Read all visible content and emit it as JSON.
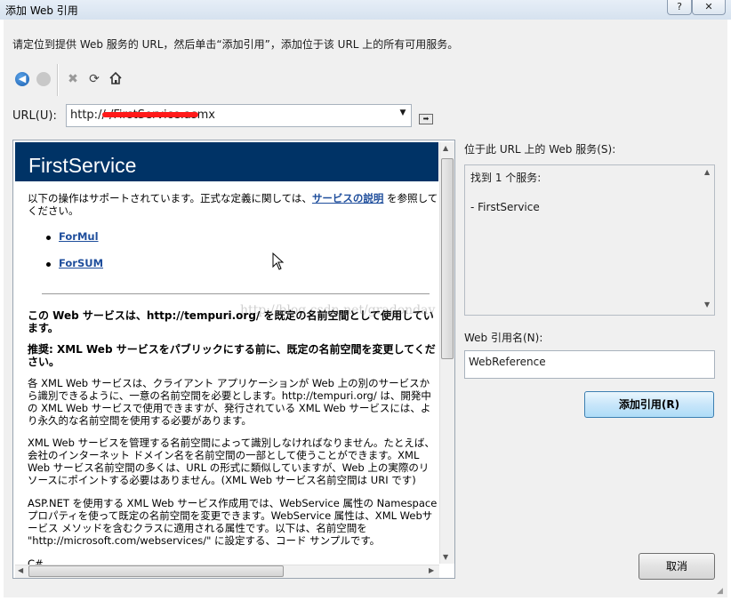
{
  "window": {
    "title": "添加 Web 引用",
    "help_button": "?",
    "close_button": "✕"
  },
  "instruction": "请定位到提供 Web 服务的 URL，然后单击“添加引用”，添加位于该 URL 上的所有可用服务。",
  "toolbar": {
    "back_icon": "arrow-left-icon",
    "stop_icon": "stop-icon",
    "cancel_icon": "x-icon",
    "refresh_icon": "refresh-icon",
    "home_icon": "home-icon"
  },
  "url": {
    "label": "URL(U):",
    "value": "http://                            /FirstService.asmx"
  },
  "browser": {
    "service_title": "FirstService",
    "intro_pre": "以下の操作はサポートされています。正式な定義に関しては、",
    "intro_link": "サービスの説明",
    "intro_post": "を参照してください。",
    "operations": [
      "ForMul",
      "ForSUM"
    ],
    "namespace_notice": "この Web サービスは、http://tempuri.org/ を既定の名前空間として使用しています。",
    "recommend_heading": "推奨: XML Web サービスをパブリックにする前に、既定の名前空間を変更してください。",
    "para1": "各 XML Web サービスは、クライアント アプリケーションが Web 上の別のサービスから識別できるように、一意の名前空間を必要とします。http://tempuri.org/ は、開発中の XML Web サービスで使用できますが、発行されている XML Web サービスには、より永久的な名前空間を使用する必要があります。",
    "para2": "XML Web サービスを管理する名前空間によって識別しなければなりません。たとえば、会社のインターネット ドメイン名を名前空間の一部として使うことができます。XML Web サービス名前空間の多くは、URL の形式に類似していますが、Web 上の実際のリソースにポイントする必要はありません。(XML Web サービス名前空間は URI です)",
    "para3": "ASP.NET を使用する XML Web サービス作成用では、WebService 属性の Namespace プロパティを使って既定の名前空間を変更できます。WebService 属性は、XML Webサービス メソッドを含むクラスに適用される属性です。以下は、名前空間を \"http://microsoft.com/webservices/\" に設定する、コード サンプルです。",
    "para4": "C#"
  },
  "services": {
    "label": "位于此 URL 上的 Web 服务(S):",
    "found_text": "找到 1 个服务:",
    "items": [
      "- FirstService"
    ]
  },
  "reference": {
    "label": "Web 引用名(N):",
    "value": "WebReference"
  },
  "buttons": {
    "add_reference": "添加引用(R)",
    "cancel": "取消"
  },
  "watermark": "http://blog.csdn.net/gradonday"
}
